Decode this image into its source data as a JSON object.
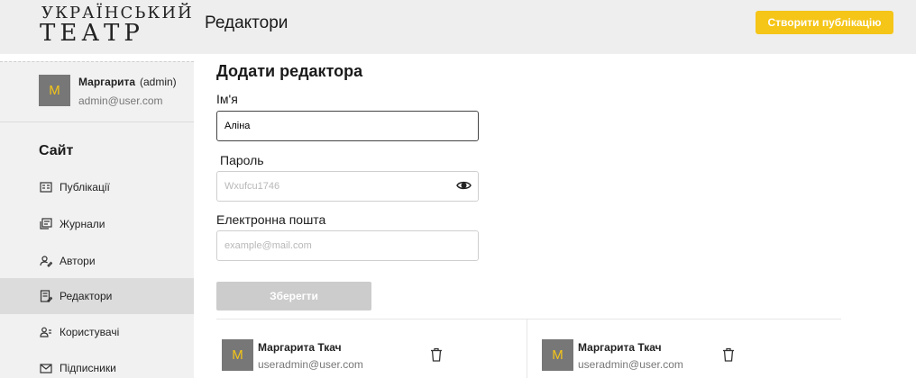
{
  "header": {
    "logo_line1": "УКРАЇНСЬКИЙ",
    "logo_line2": "ТЕАТР",
    "page_title": "Редактори",
    "create_button": "Створити публікацію"
  },
  "sidebar": {
    "user": {
      "avatar": "M",
      "name": "Маргарита",
      "role": "(admin)",
      "email": "admin@user.com"
    },
    "section_title": "Сайт",
    "items": [
      {
        "label": "Публікації",
        "icon": "publications-icon"
      },
      {
        "label": "Журнали",
        "icon": "journals-icon"
      },
      {
        "label": "Автори",
        "icon": "authors-icon"
      },
      {
        "label": "Редактори",
        "icon": "editors-icon",
        "active": true
      },
      {
        "label": "Користувачі",
        "icon": "users-icon"
      },
      {
        "label": "Підписники",
        "icon": "subscribers-icon"
      }
    ]
  },
  "form": {
    "title": "Додати редактора",
    "name_label": "Ім'я",
    "name_value": "Аліна",
    "password_label": "Пароль",
    "password_placeholder": "Wxufcu1746",
    "email_label": "Електронна пошта",
    "email_placeholder": "example@mail.com",
    "save_button": "Зберегти"
  },
  "editors": [
    {
      "avatar": "M",
      "name": "Маргарита Ткач",
      "email": "useradmin@user.com"
    },
    {
      "avatar": "M",
      "name": "Маргарита Ткач",
      "email": "useradmin@user.com"
    }
  ],
  "colors": {
    "accent": "#f5c518",
    "avatar_bg": "#777777",
    "sidebar_bg": "#f1f1f1",
    "header_bg": "#eeeeee"
  }
}
